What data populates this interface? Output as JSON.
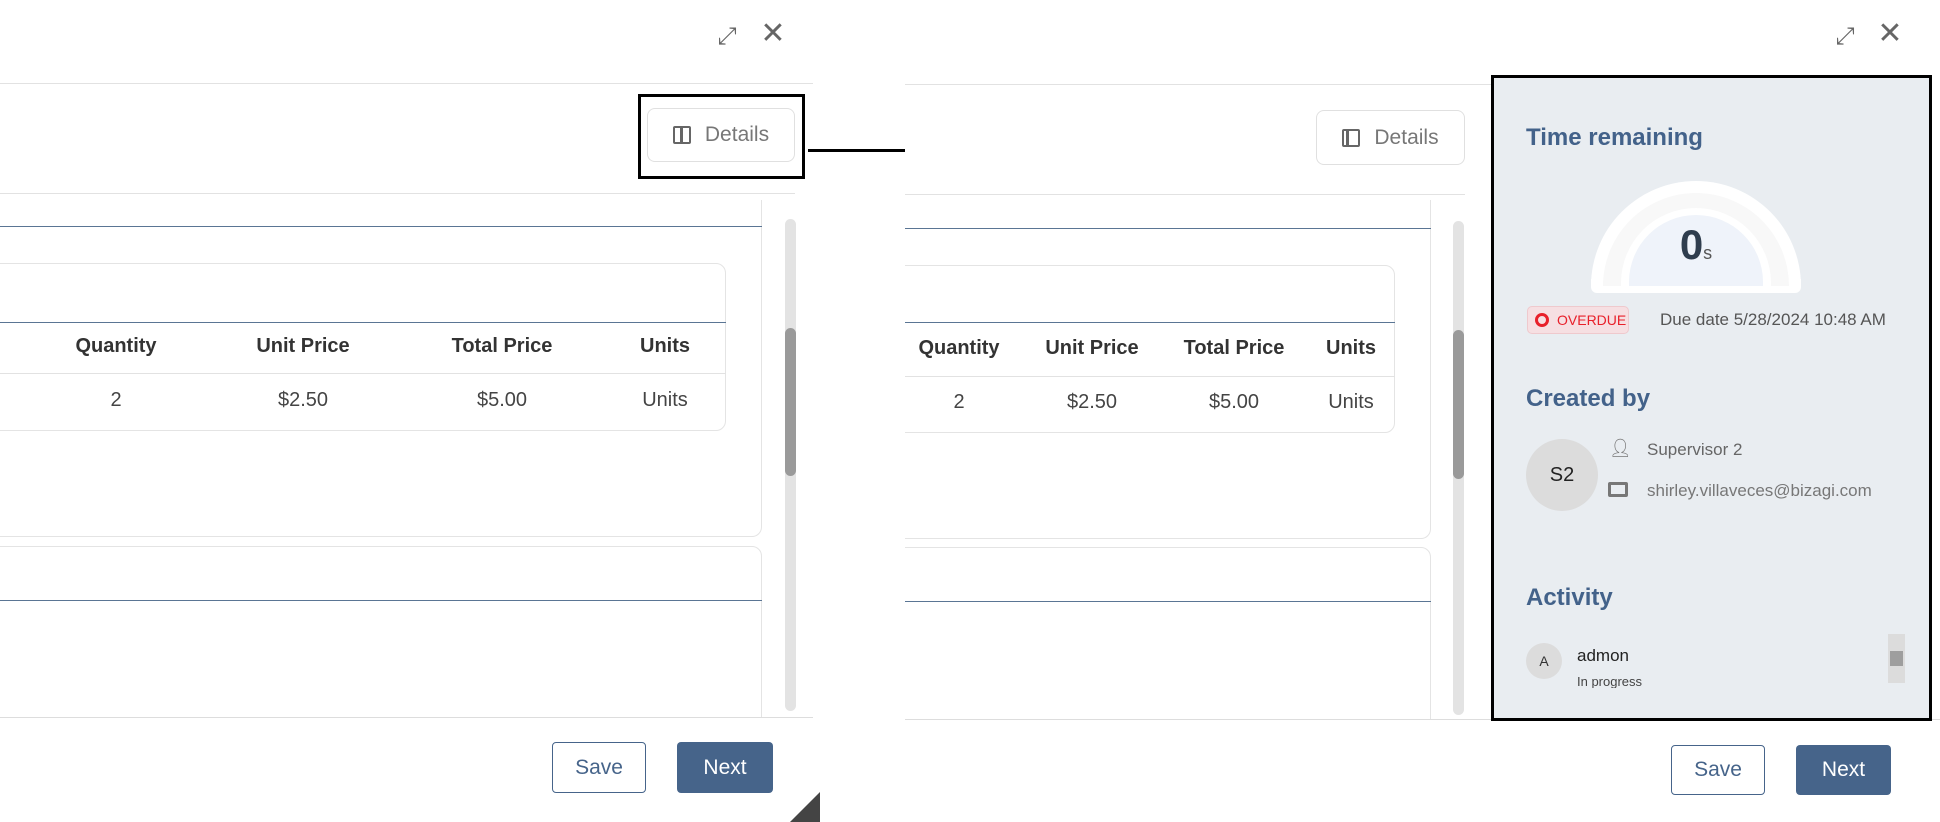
{
  "left_view": {
    "details_label": "Details",
    "table": {
      "headers": [
        "Quantity",
        "Unit Price",
        "Total Price",
        "Units"
      ],
      "rows": [
        [
          "2",
          "$2.50",
          "$5.00",
          "Units"
        ]
      ]
    },
    "save_label": "Save",
    "next_label": "Next"
  },
  "right_view": {
    "details_label": "Details",
    "table": {
      "headers": [
        "Quantity",
        "Unit Price",
        "Total Price",
        "Units"
      ],
      "rows": [
        [
          "2",
          "$2.50",
          "$5.00",
          "Units"
        ]
      ]
    },
    "save_label": "Save",
    "next_label": "Next",
    "details_panel": {
      "time_remaining_title": "Time remaining",
      "time_value": "0",
      "time_unit": "s",
      "status_badge": "OVERDUE",
      "due_date": "Due date 5/28/2024 10:48 AM",
      "created_by_title": "Created by",
      "creator_initials": "S2",
      "creator_name": "Supervisor 2",
      "creator_email": "shirley.villaveces@bizagi.com",
      "activity_title": "Activity",
      "activity": [
        {
          "initial": "A",
          "user": "admon",
          "status": "In progress"
        }
      ]
    }
  },
  "colors": {
    "accent": "#46648a",
    "heading": "#43628a",
    "panel_bg": "#e9edf1",
    "overdue": "#e8202a"
  },
  "icons": [
    "expand-icon",
    "close-icon",
    "panel-toggle-icon",
    "user-icon",
    "mail-icon"
  ]
}
